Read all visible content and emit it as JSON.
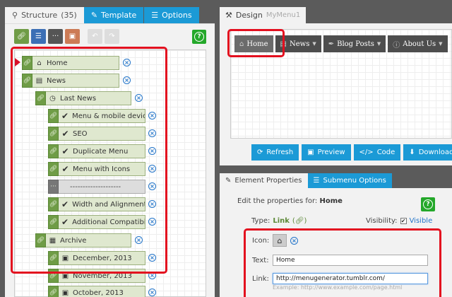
{
  "left_tabs": [
    {
      "label": "Structure",
      "count": "(35)",
      "icon": "sitemap-icon"
    },
    {
      "label": "Template",
      "icon": "brush-icon"
    },
    {
      "label": "Options",
      "icon": "list-icon"
    }
  ],
  "toolbar": {
    "tools": [
      "add-link",
      "add-list",
      "add-separator",
      "add-image"
    ],
    "undo_icon": "undo-icon",
    "redo_icon": "redo-icon",
    "help_glyph": "?"
  },
  "tree": {
    "items": [
      {
        "label": "Home",
        "icon": "home-icon"
      },
      {
        "label": "News",
        "icon": "newspaper-icon"
      },
      {
        "label": "Last News",
        "icon": "clock-icon"
      },
      {
        "label": "Menu & mobile devices",
        "icon": "check-icon"
      },
      {
        "label": "SEO",
        "icon": "check-icon"
      },
      {
        "label": "Duplicate Menu",
        "icon": "check-icon"
      },
      {
        "label": "Menu with Icons",
        "icon": "check-icon"
      },
      {
        "label": "--------------------",
        "icon": "separator"
      },
      {
        "label": "Width and Alignment",
        "icon": "check-icon"
      },
      {
        "label": "Additional Compatibility",
        "icon": "check-icon"
      },
      {
        "label": "Archive",
        "icon": "calendar-icon"
      },
      {
        "label": "December, 2013",
        "icon": "archive-icon"
      },
      {
        "label": "November, 2013",
        "icon": "archive-icon"
      },
      {
        "label": "October, 2013",
        "icon": "archive-icon"
      }
    ],
    "delete_glyph": "×"
  },
  "design": {
    "tab_label": "Design",
    "menu_name": "MyMenu1",
    "menu_items": [
      {
        "label": "Home",
        "icon": "home-icon",
        "has_caret": false
      },
      {
        "label": "News",
        "icon": "newspaper-icon",
        "has_caret": true
      },
      {
        "label": "Blog Posts",
        "icon": "pen-icon",
        "has_caret": true
      },
      {
        "label": "About Us",
        "icon": "info-icon",
        "has_caret": true
      }
    ],
    "buttons": [
      {
        "label": "Refresh",
        "icon": "refresh-icon"
      },
      {
        "label": "Preview",
        "icon": "preview-icon"
      },
      {
        "label": "Code",
        "icon": "code-icon"
      },
      {
        "label": "Download",
        "icon": "download-icon"
      }
    ]
  },
  "properties": {
    "tabs": [
      {
        "label": "Element Properties",
        "icon": "edit-icon"
      },
      {
        "label": "Submenu Options",
        "icon": "list-icon"
      }
    ],
    "edit_prefix": "Edit the properties for:",
    "edit_target": "Home",
    "type_label": "Type:",
    "type_value": "Link",
    "visibility_label": "Visibility:",
    "visibility_value": "Visible",
    "visibility_checked": true,
    "icon_label": "Icon:",
    "icon_value": "home-icon",
    "text_label": "Text:",
    "text_value": "Home",
    "link_label": "Link:",
    "link_value": "http://menugenerator.tumblr.com/",
    "link_example": "Example: http://www.example.com/page.html"
  },
  "colors": {
    "accent_blue": "#1b9ad6",
    "tree_green": "#6f9c46",
    "highlight_red": "#e3101f",
    "help_green": "#24a82a"
  }
}
